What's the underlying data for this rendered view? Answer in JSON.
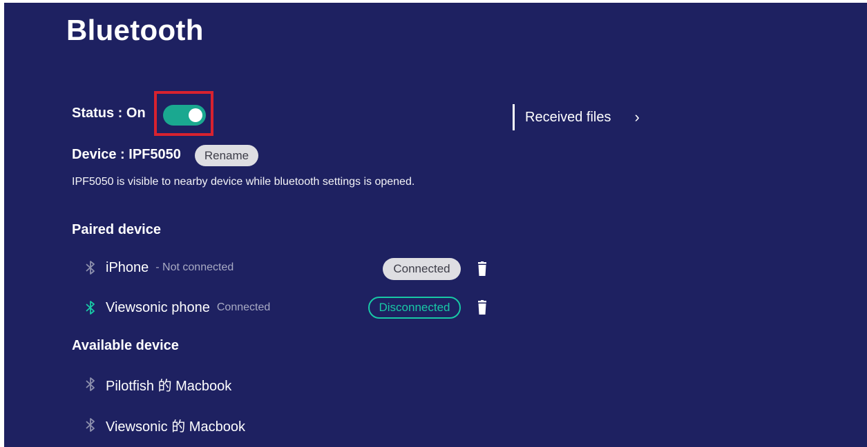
{
  "title": "Bluetooth",
  "status": {
    "label": "Status : On",
    "enabled": true,
    "toggle_color": "#1aa890",
    "highlight_color": "#d8222f"
  },
  "device": {
    "label": "Device : IPF5050",
    "rename_label": "Rename"
  },
  "visibility_note": "IPF5050 is visible to nearby device while bluetooth settings is opened.",
  "received_files": {
    "label": "Received files",
    "chevron": "›"
  },
  "paired": {
    "title": "Paired device",
    "items": [
      {
        "name": "iPhone",
        "status": "- Not connected",
        "action": "Connected",
        "icon": "bluetooth-icon",
        "icon_color": "#8d90ad"
      },
      {
        "name": "Viewsonic phone",
        "status": "Connected",
        "action": "Disconnected",
        "icon": "bluetooth-icon",
        "icon_color": "#18c9a6"
      }
    ]
  },
  "available": {
    "title": "Available device",
    "items": [
      {
        "name": "Pilotfish 的 Macbook",
        "icon": "bluetooth-icon",
        "icon_color": "#8d90ad"
      },
      {
        "name": "Viewsonic 的 Macbook",
        "icon": "bluetooth-icon",
        "icon_color": "#8d90ad"
      }
    ]
  },
  "colors": {
    "background": "#1e2161",
    "accent": "#18c9a6"
  }
}
